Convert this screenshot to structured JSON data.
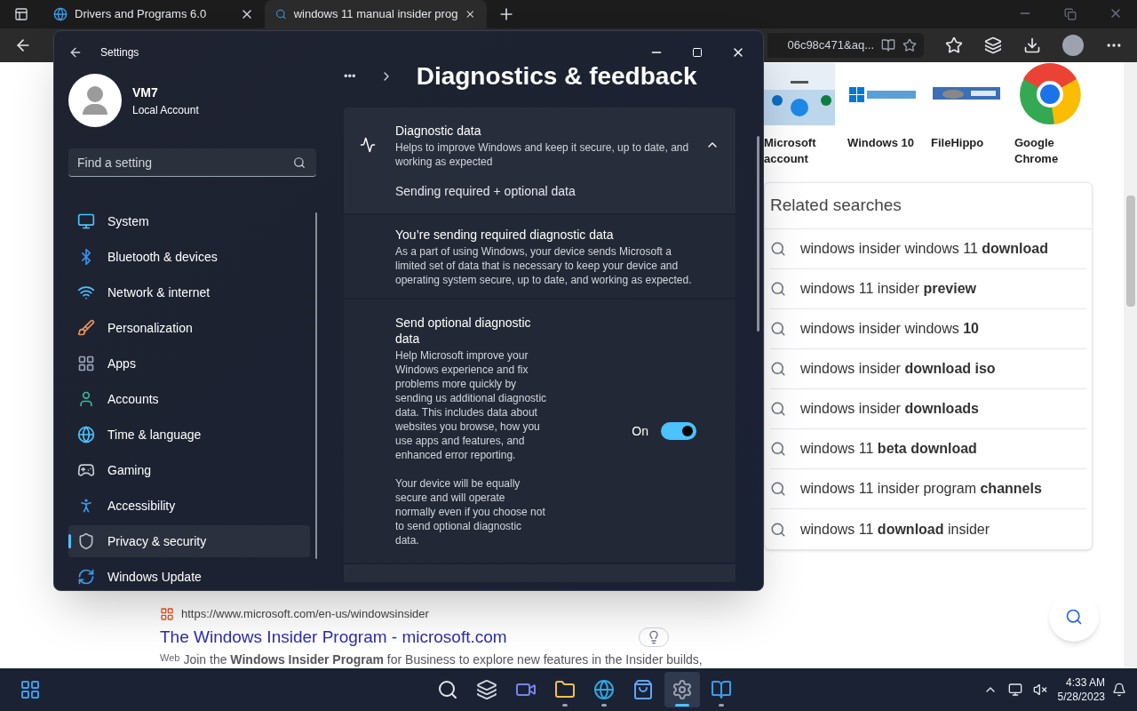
{
  "browser": {
    "tabs": [
      {
        "label": "Drivers and Programs 6.0",
        "selected": false
      },
      {
        "label": "windows 11 manual insider prog",
        "selected": true
      }
    ],
    "address": "06c98c471&aq..."
  },
  "page": {
    "images": [
      {
        "label": "Microsoft account",
        "kind": "picture"
      },
      {
        "label": "Windows 10",
        "kind": "picture"
      },
      {
        "label": "FileHippo",
        "kind": "picture"
      },
      {
        "label": "Google Chrome",
        "kind": "picture"
      }
    ],
    "related": {
      "title": "Related searches",
      "items": [
        "windows insider windows 11 **download**",
        "windows 11 insider **preview**",
        "windows insider windows **10**",
        "windows insider **download iso**",
        "windows insider **downloads**",
        "windows 11 **beta download**",
        "windows 11 insider program **channels**",
        "windows 11 **download** insider"
      ]
    },
    "result": {
      "url": "https://www.microsoft.com/en-us/windowsinsider",
      "title": "The Windows Insider Program - microsoft.com",
      "tag": "Web",
      "snippet": "Join the **Windows Insider Program** for Business to explore new features in the Insider builds,"
    }
  },
  "settings": {
    "title": "Settings",
    "user": {
      "name": "VM7",
      "account": "Local Account"
    },
    "search": {
      "placeholder": "Find a setting"
    },
    "nav": [
      {
        "label": "System",
        "selected": false
      },
      {
        "label": "Bluetooth & devices",
        "selected": false
      },
      {
        "label": "Network & internet",
        "selected": false
      },
      {
        "label": "Personalization",
        "selected": false
      },
      {
        "label": "Apps",
        "selected": false
      },
      {
        "label": "Accounts",
        "selected": false
      },
      {
        "label": "Time & language",
        "selected": false
      },
      {
        "label": "Gaming",
        "selected": false
      },
      {
        "label": "Accessibility",
        "selected": false
      },
      {
        "label": "Privacy & security",
        "selected": true
      },
      {
        "label": "Windows Update",
        "selected": false
      }
    ],
    "breadcrumb": {
      "more": "•••",
      "title": "Diagnostics & feedback"
    },
    "diagnostic": {
      "title": "Diagnostic data",
      "description": "Helps to improve Windows and keep it secure, up to date, and working as expected",
      "expanded": true,
      "status": "Sending required + optional data",
      "required": {
        "title": "You’re sending required diagnostic data",
        "description": "As a part of using Windows, your device sends Microsoft a limited set of data that is necessary to keep your device and operating system secure, up to date, and working as expected."
      },
      "optional": {
        "title": "Send optional diagnostic data",
        "description": "Help Microsoft improve your Windows experience and fix problems more quickly by sending us additional diagnostic data. This includes data about websites you browse, how you use apps and features, and enhanced error reporting.",
        "note": "Your device will be equally secure and will operate normally even if you choose not to send optional diagnostic data.",
        "state": "On",
        "on": true
      }
    }
  },
  "taskbar": {
    "apps": [
      {
        "running": false,
        "selected": false
      },
      {
        "running": false,
        "selected": false
      },
      {
        "running": false,
        "selected": false
      },
      {
        "running": false,
        "selected": false
      },
      {
        "running": true,
        "selected": false
      },
      {
        "running": true,
        "selected": false
      },
      {
        "running": false,
        "selected": false
      },
      {
        "running": true,
        "selected": true
      },
      {
        "running": true,
        "selected": false
      }
    ],
    "time": "4:33 AM",
    "date": "5/28/2023"
  }
}
